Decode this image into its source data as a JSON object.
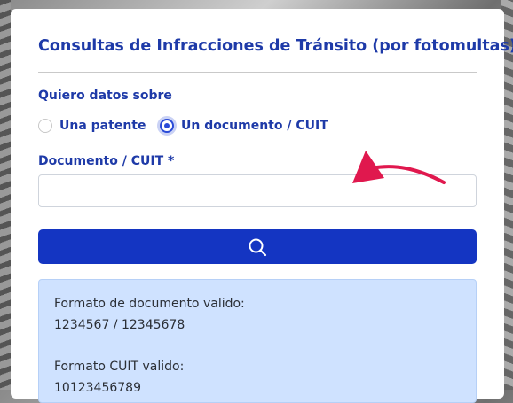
{
  "form": {
    "title": "Consultas de Infracciones de Tránsito (por fotomultas)",
    "query_label": "Quiero datos sobre",
    "options": [
      {
        "label": "Una patente",
        "checked": false
      },
      {
        "label": "Un documento / CUIT",
        "checked": true
      }
    ],
    "document_label": "Documento / CUIT *",
    "document_value": "",
    "search_icon": "search-icon"
  },
  "info": {
    "doc_format_label": "Formato de documento valido:",
    "doc_format_example": "1234567 / 12345678",
    "cuit_format_label": "Formato CUIT valido:",
    "cuit_format_example": "10123456789"
  },
  "colors": {
    "heading": "#1e3aa8",
    "button": "#1435c2",
    "info_bg": "#cfe2ff",
    "arrow": "#e0184e"
  }
}
